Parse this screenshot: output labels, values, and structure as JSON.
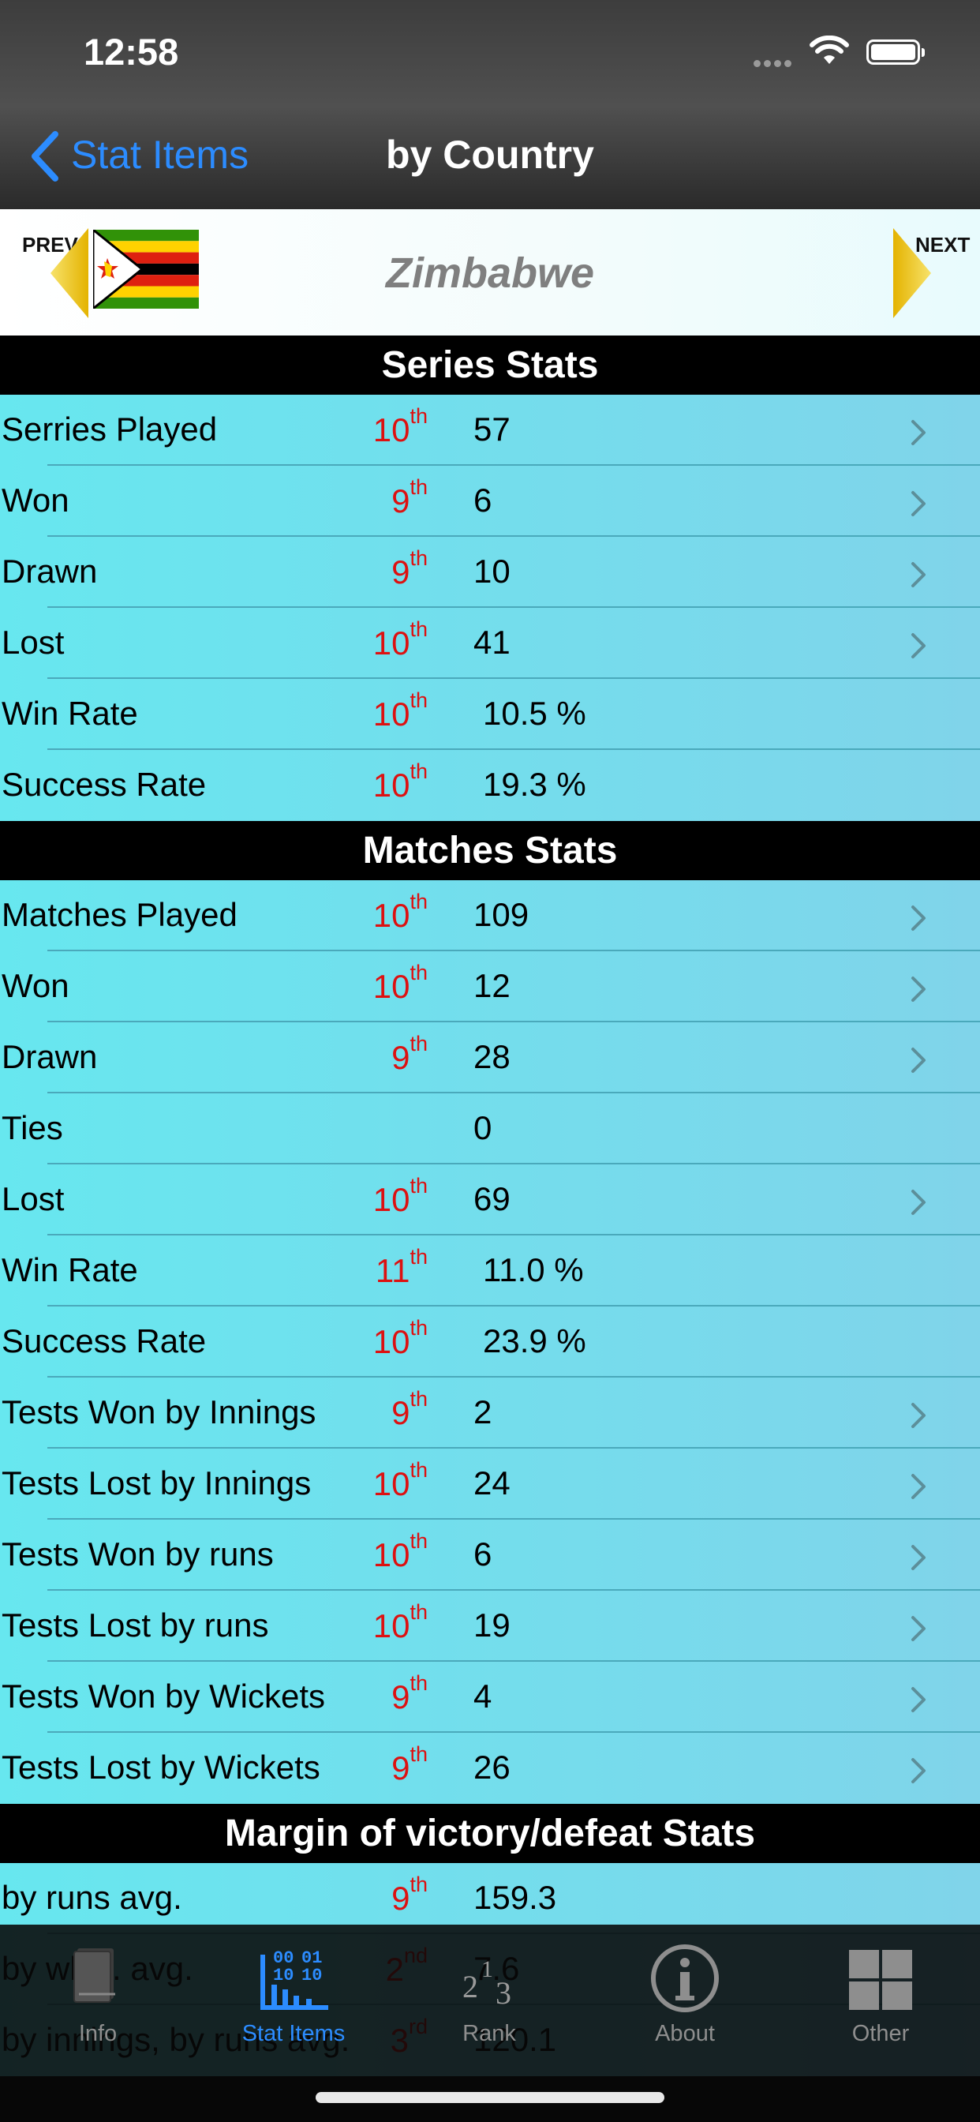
{
  "status": {
    "time": "12:58"
  },
  "nav": {
    "back_label": "Stat Items",
    "title": "by Country"
  },
  "country": {
    "prev_label": "PREV",
    "name": "Zimbabwe",
    "next_label": "NEXT"
  },
  "sections": [
    {
      "title": "Series Stats",
      "rows": [
        {
          "label": "Serries Played",
          "value": "57",
          "rank_num": "10",
          "rank_suffix": "th",
          "has_chevron": true
        },
        {
          "label": "Won",
          "value": "6",
          "rank_num": "9",
          "rank_suffix": "th",
          "has_chevron": true
        },
        {
          "label": "Drawn",
          "value": "10",
          "rank_num": "9",
          "rank_suffix": "th",
          "has_chevron": true
        },
        {
          "label": "Lost",
          "value": "41",
          "rank_num": "10",
          "rank_suffix": "th",
          "has_chevron": true
        },
        {
          "label": "Win Rate",
          "value": "10.5 %",
          "rank_num": "10",
          "rank_suffix": "th",
          "has_chevron": false
        },
        {
          "label": "Success Rate",
          "value": "19.3 %",
          "rank_num": "10",
          "rank_suffix": "th",
          "has_chevron": false
        }
      ]
    },
    {
      "title": "Matches Stats",
      "rows": [
        {
          "label": "Matches Played",
          "value": "109",
          "rank_num": "10",
          "rank_suffix": "th",
          "has_chevron": true
        },
        {
          "label": "Won",
          "value": "12",
          "rank_num": "10",
          "rank_suffix": "th",
          "has_chevron": true
        },
        {
          "label": "Drawn",
          "value": "28",
          "rank_num": "9",
          "rank_suffix": "th",
          "has_chevron": true
        },
        {
          "label": "Ties",
          "value": "0",
          "rank_num": "",
          "rank_suffix": "",
          "has_chevron": false
        },
        {
          "label": "Lost",
          "value": "69",
          "rank_num": "10",
          "rank_suffix": "th",
          "has_chevron": true
        },
        {
          "label": "Win Rate",
          "value": "11.0 %",
          "rank_num": "11",
          "rank_suffix": "th",
          "has_chevron": false
        },
        {
          "label": "Success Rate",
          "value": "23.9 %",
          "rank_num": "10",
          "rank_suffix": "th",
          "has_chevron": false
        },
        {
          "label": "Tests Won by Innings",
          "value": "2",
          "rank_num": "9",
          "rank_suffix": "th",
          "has_chevron": true
        },
        {
          "label": "Tests Lost by Innings",
          "value": "24",
          "rank_num": "10",
          "rank_suffix": "th",
          "has_chevron": true
        },
        {
          "label": "Tests Won by runs",
          "value": "6",
          "rank_num": "10",
          "rank_suffix": "th",
          "has_chevron": true
        },
        {
          "label": "Tests Lost by runs",
          "value": "19",
          "rank_num": "10",
          "rank_suffix": "th",
          "has_chevron": true
        },
        {
          "label": "Tests Won by Wickets",
          "value": "4",
          "rank_num": "9",
          "rank_suffix": "th",
          "has_chevron": true
        },
        {
          "label": "Tests Lost by Wickets",
          "value": "26",
          "rank_num": "9",
          "rank_suffix": "th",
          "has_chevron": true
        }
      ]
    },
    {
      "title": "Margin of victory/defeat Stats",
      "rows": [
        {
          "label": "by runs avg.",
          "value": "159.3",
          "rank_num": "9",
          "rank_suffix": "th",
          "has_chevron": false
        },
        {
          "label": "by wkts. avg.",
          "value": "7.6",
          "rank_num": "2",
          "rank_suffix": "nd",
          "has_chevron": false
        },
        {
          "label": "by innings, by runs avg.",
          "value": "120.1",
          "rank_num": "3",
          "rank_suffix": "rd",
          "has_chevron": false
        }
      ]
    }
  ],
  "tabs": [
    {
      "label": "Info",
      "icon": "book-icon",
      "active": false
    },
    {
      "label": "Stat Items",
      "icon": "binary-chart-icon",
      "active": true
    },
    {
      "label": "Rank",
      "icon": "rank-numbers-icon",
      "active": false
    },
    {
      "label": "About",
      "icon": "info-circle-icon",
      "active": false
    },
    {
      "label": "Other",
      "icon": "grid-icon",
      "active": false
    }
  ],
  "colors": {
    "accent": "#2c8cff",
    "rank": "#dd1111",
    "row_bg": "#6fe0ee",
    "header_bg": "#000000"
  }
}
